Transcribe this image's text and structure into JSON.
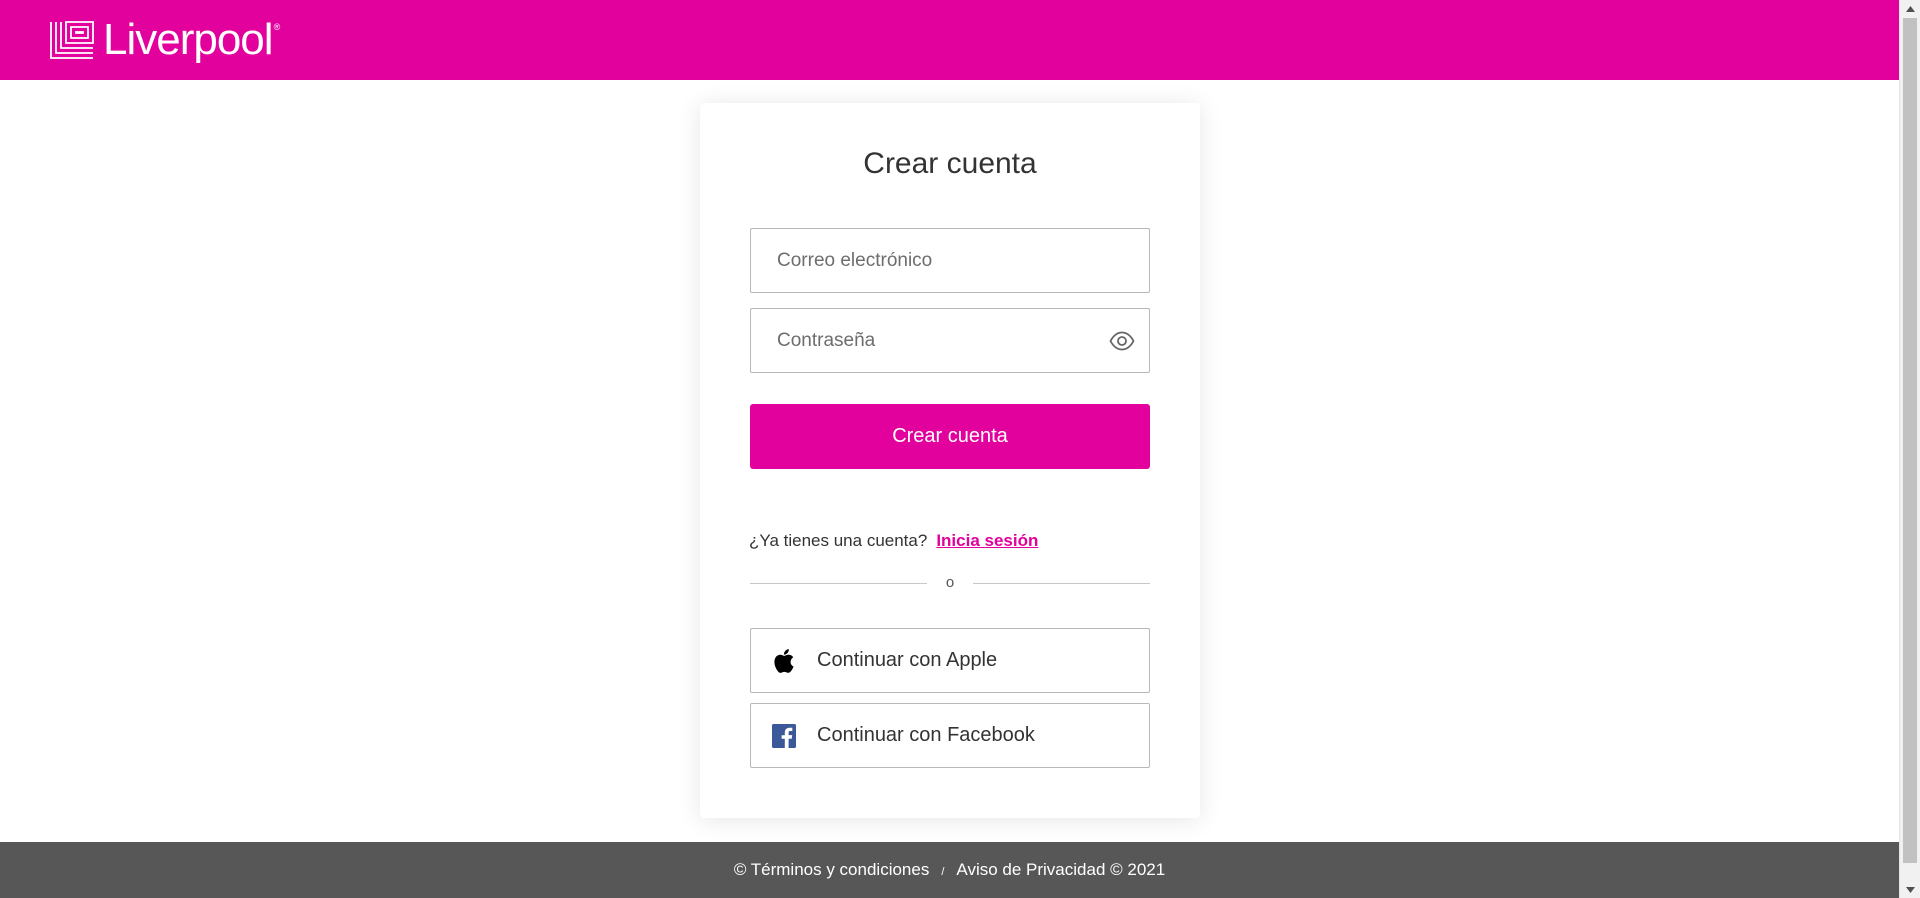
{
  "brand": {
    "name": "Liverpool",
    "registered_mark": "®",
    "primary_color": "#e2019c",
    "footer_color": "#575757"
  },
  "form": {
    "title": "Crear cuenta",
    "email_placeholder": "Correo electrónico",
    "password_placeholder": "Contraseña",
    "submit_label": "Crear cuenta",
    "have_account_text": "¿Ya tienes una cuenta?",
    "login_link": "Inicia sesión",
    "divider_text": "o"
  },
  "social": [
    {
      "label": "Continuar con Apple",
      "icon": "apple-icon"
    },
    {
      "label": "Continuar con Facebook",
      "icon": "facebook-icon"
    }
  ],
  "footer": {
    "terms": "© Términos y condiciones",
    "separator": "/",
    "privacy": "Aviso de Privacidad © 2021"
  }
}
